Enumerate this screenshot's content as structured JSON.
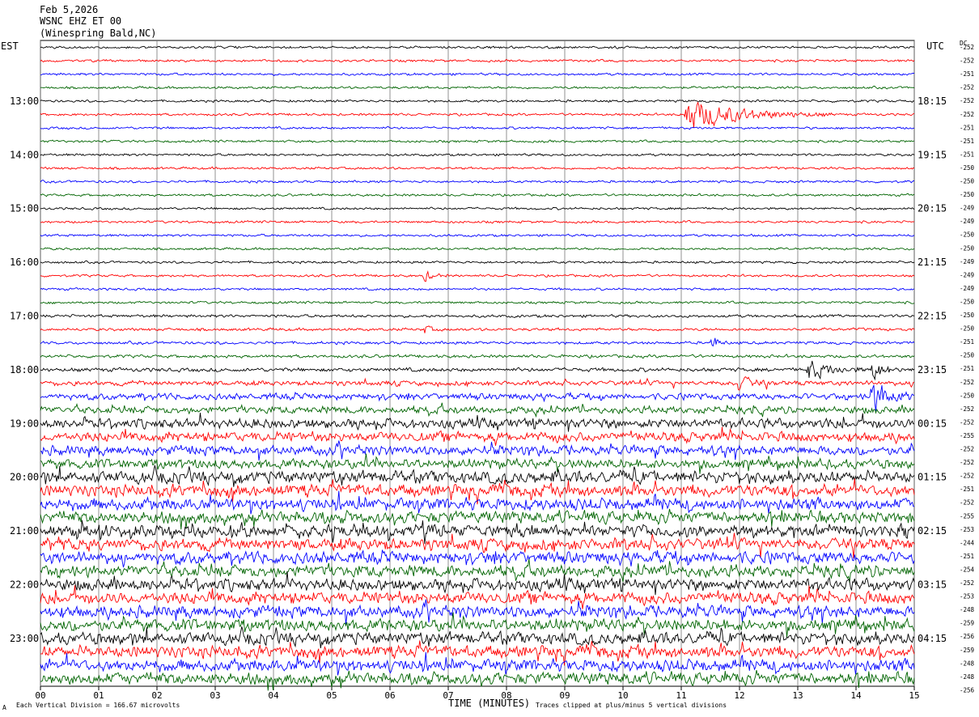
{
  "header": {
    "date": "Feb 5,2026",
    "station": "WSNC EHZ ET 00",
    "location": "(Winespring Bald,NC)"
  },
  "left_label": "EST",
  "right_label": "UTC",
  "dc_label": "DC",
  "footer": {
    "mark": "A",
    "scale_note": "Each Vertical Division =  166.67 microvolts",
    "clip_note": "Traces clipped at plus/minus 5 vertical divisions"
  },
  "colors": {
    "trace_cycle": [
      "#000000",
      "#ff0000",
      "#0000ff",
      "#006400"
    ],
    "grid": "#000000"
  },
  "chart_data": {
    "type": "line",
    "title": "",
    "xlabel": "TIME (MINUTES)",
    "xlim": [
      0,
      15
    ],
    "x_ticks": [
      "00",
      "01",
      "02",
      "03",
      "04",
      "05",
      "06",
      "07",
      "08",
      "09",
      "10",
      "11",
      "12",
      "13",
      "14",
      "15"
    ],
    "rows_per_hour": 4,
    "minutes_per_row": 15,
    "row_count": 48,
    "est_hour_labels": [
      {
        "row": 4,
        "label": "13:00"
      },
      {
        "row": 8,
        "label": "14:00"
      },
      {
        "row": 12,
        "label": "15:00"
      },
      {
        "row": 16,
        "label": "16:00"
      },
      {
        "row": 20,
        "label": "17:00"
      },
      {
        "row": 24,
        "label": "18:00"
      },
      {
        "row": 28,
        "label": "19:00"
      },
      {
        "row": 32,
        "label": "20:00"
      },
      {
        "row": 36,
        "label": "21:00"
      },
      {
        "row": 40,
        "label": "22:00"
      },
      {
        "row": 44,
        "label": "23:00"
      }
    ],
    "utc_hour_labels": [
      {
        "row": 4,
        "label": "18:15"
      },
      {
        "row": 8,
        "label": "19:15"
      },
      {
        "row": 12,
        "label": "20:15"
      },
      {
        "row": 16,
        "label": "21:15"
      },
      {
        "row": 20,
        "label": "22:15"
      },
      {
        "row": 24,
        "label": "23:15"
      },
      {
        "row": 28,
        "label": "00:15"
      },
      {
        "row": 32,
        "label": "01:15"
      },
      {
        "row": 36,
        "label": "02:15"
      },
      {
        "row": 40,
        "label": "03:15"
      },
      {
        "row": 44,
        "label": "04:15"
      }
    ],
    "dc_offsets": [
      "-252",
      "-252",
      "-251",
      "-252",
      "-252",
      "-252",
      "-251",
      "-251",
      "-251",
      "-250",
      "-250",
      "-250",
      "-249",
      "-249",
      "-250",
      "-250",
      "-249",
      "-249",
      "-249",
      "-250",
      "-250",
      "-250",
      "-251",
      "-250",
      "-251",
      "-252",
      "-250",
      "-252",
      "-252",
      "-255",
      "-252",
      "-252",
      "-252",
      "-251",
      "-252",
      "-255",
      "-253",
      "-244",
      "-251",
      "-254",
      "-252",
      "-253",
      "-248",
      "-259",
      "-256",
      "-259",
      "-248",
      "-248",
      "-256"
    ],
    "row_amplitude_levels": [
      1,
      1,
      1,
      1,
      1,
      1,
      1,
      1,
      1,
      1,
      1,
      1,
      1,
      1,
      1,
      1,
      1,
      1,
      1,
      1,
      1.2,
      1.2,
      1.2,
      1.3,
      1.6,
      2,
      2.6,
      3,
      4,
      4,
      4,
      4,
      5,
      5,
      5,
      5,
      5,
      5,
      5,
      5,
      5,
      5,
      5,
      5,
      5,
      5,
      5,
      5
    ],
    "events": [
      {
        "row": 5,
        "minute": 11.1,
        "peak_divisions": 5,
        "decay_minutes": 2.5
      },
      {
        "row": 17,
        "minute": 6.6,
        "peak_divisions": 1.5,
        "decay_minutes": 0.4
      },
      {
        "row": 21,
        "minute": 6.6,
        "peak_divisions": 1.2,
        "decay_minutes": 0.3
      },
      {
        "row": 22,
        "minute": 11.55,
        "peak_divisions": 2,
        "decay_minutes": 0.3
      },
      {
        "row": 24,
        "minute": 13.2,
        "peak_divisions": 3,
        "decay_minutes": 1.0
      },
      {
        "row": 24,
        "minute": 14.3,
        "peak_divisions": 3,
        "decay_minutes": 0.5
      },
      {
        "row": 25,
        "minute": 12.0,
        "peak_divisions": 2,
        "decay_minutes": 0.6
      },
      {
        "row": 26,
        "minute": 14.3,
        "peak_divisions": 4,
        "decay_minutes": 1.0
      }
    ]
  }
}
